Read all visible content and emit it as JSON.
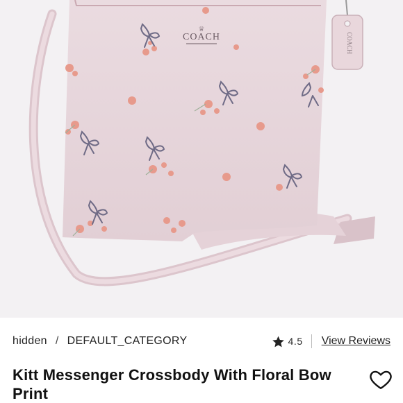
{
  "product_image": {
    "brand_logo_text": "COACH",
    "alt": "Kitt Messenger Crossbody With Floral Bow Print"
  },
  "breadcrumb": {
    "items": [
      "hidden",
      "DEFAULT_CATEGORY"
    ],
    "separator": "/"
  },
  "rating": {
    "value": "4.5",
    "icon": "star-icon",
    "reviews_link": "View Reviews"
  },
  "product": {
    "title": "Kitt Messenger Crossbody With Floral Bow Print"
  },
  "favorite": {
    "icon": "heart-outline-icon"
  },
  "colors": {
    "background": "#f3f1f3",
    "bag": "#e8d6dc",
    "flower": "#e79a8c",
    "bow": "#6f6b86",
    "text": "#222222"
  }
}
